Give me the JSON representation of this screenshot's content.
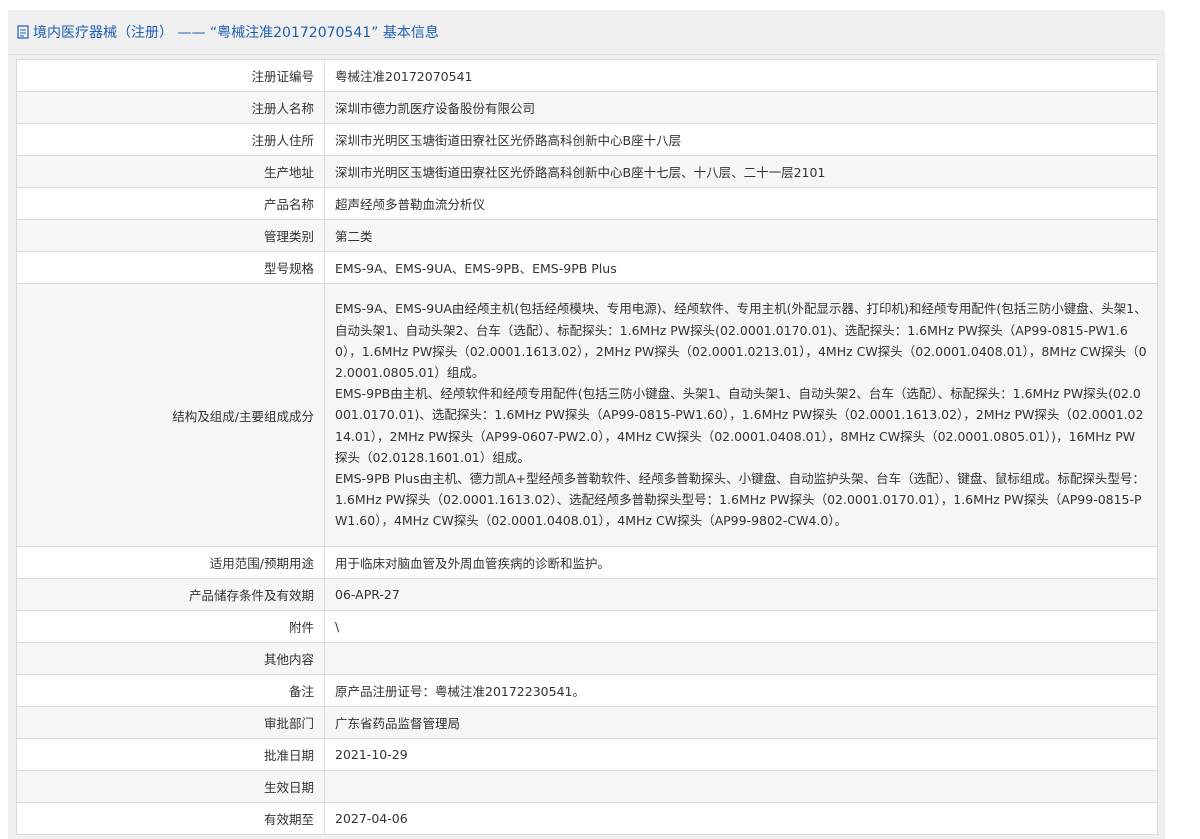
{
  "header": {
    "title": "境内医疗器械（注册） —— “粤械注准20172070541” 基本信息"
  },
  "rows": [
    {
      "label": "注册证编号",
      "value": "粤械注准20172070541"
    },
    {
      "label": "注册人名称",
      "value": "深圳市德力凯医疗设备股份有限公司"
    },
    {
      "label": "注册人住所",
      "value": "深圳市光明区玉塘街道田寮社区光侨路高科创新中心B座十八层"
    },
    {
      "label": "生产地址",
      "value": "深圳市光明区玉塘街道田寮社区光侨路高科创新中心B座十七层、十八层、二十一层2101"
    },
    {
      "label": "产品名称",
      "value": "超声经颅多普勒血流分析仪"
    },
    {
      "label": "管理类别",
      "value": "第二类"
    },
    {
      "label": "型号规格",
      "value": "EMS-9A、EMS-9UA、EMS-9PB、EMS-9PB Plus"
    },
    {
      "label": "结构及组成/主要组成成分",
      "paragraphs": [
        "EMS-9A、EMS-9UA由经颅主机(包括经颅模块、专用电源)、经颅软件、专用主机(外配显示器、打印机)和经颅专用配件(包括三防小键盘、头架1、自动头架1、自动头架2、台车（选配）、标配探头：1.6MHz PW探头(02.0001.0170.01)、选配探头：1.6MHz PW探头（AP99-0815-PW1.60），1.6MHz PW探头（02.0001.1613.02），2MHz PW探头（02.0001.0213.01），4MHz CW探头（02.0001.0408.01），8MHz CW探头（02.0001.0805.01）组成。",
        "EMS-9PB由主机、经颅软件和经颅专用配件(包括三防小键盘、头架1、自动头架1、自动头架2、台车（选配）、标配探头：1.6MHz PW探头(02.0001.0170.01)、选配探头：1.6MHz PW探头（AP99-0815-PW1.60），1.6MHz PW探头（02.0001.1613.02），2MHz PW探头（02.0001.0214.01），2MHz PW探头（AP99-0607-PW2.0），4MHz CW探头（02.0001.0408.01），8MHz CW探头（02.0001.0805.01）)，16MHz PW探头（02.0128.1601.01）组成。",
        "EMS-9PB Plus由主机、德力凯A+型经颅多普勒软件、经颅多普勒探头、小键盘、自动监护头架、台车（选配）、键盘、鼠标组成。标配探头型号：1.6MHz PW探头（02.0001.1613.02）、选配经颅多普勒探头型号：1.6MHz PW探头（02.0001.0170.01），1.6MHz PW探头（AP99-0815-PW1.60），4MHz CW探头（02.0001.0408.01），4MHz CW探头（AP99-9802-CW4.0）。"
      ]
    },
    {
      "label": "适用范围/预期用途",
      "value": "用于临床对脑血管及外周血管疾病的诊断和监护。"
    },
    {
      "label": "产品储存条件及有效期",
      "value": "06-APR-27"
    },
    {
      "label": "附件",
      "value": "\\"
    },
    {
      "label": "其他内容",
      "value": ""
    },
    {
      "label": "备注",
      "value": "原产品注册证号：粤械注准20172230541。"
    },
    {
      "label": "审批部门",
      "value": "广东省药品监督管理局"
    },
    {
      "label": "批准日期",
      "value": "2021-10-29"
    },
    {
      "label": "生效日期",
      "value": ""
    },
    {
      "label": "有效期至",
      "value": "2027-04-06"
    }
  ]
}
